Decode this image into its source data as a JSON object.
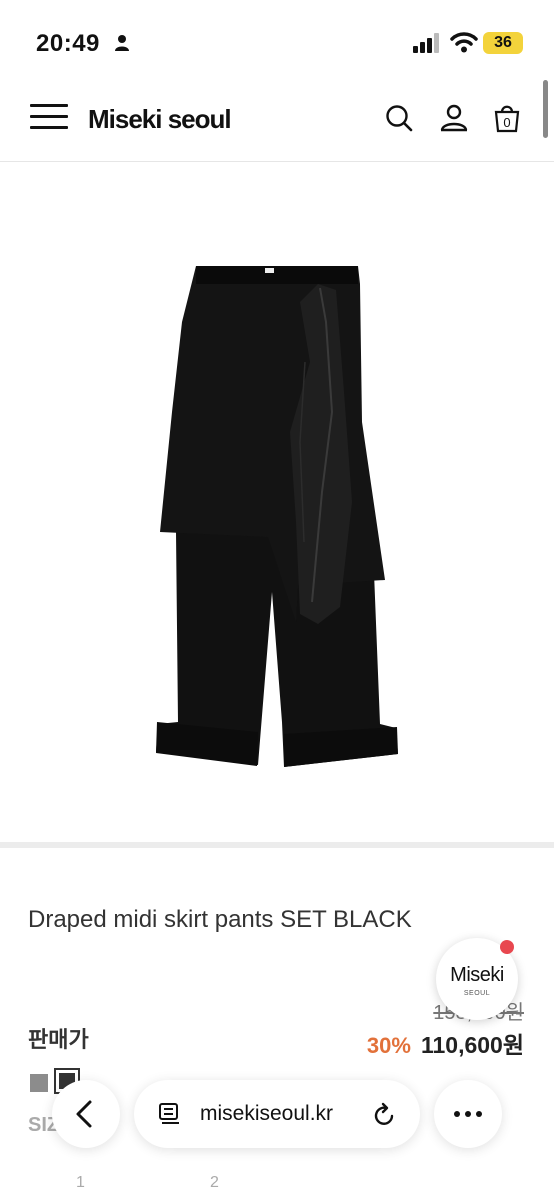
{
  "status_bar": {
    "time": "20:49",
    "battery": "36"
  },
  "header": {
    "brand": "Miseki seoul",
    "cart_count": "0"
  },
  "product": {
    "title": "Draped midi skirt pants SET BLACK",
    "price_label": "판매가",
    "original_price": "158,000원",
    "discount": "30%",
    "sale_price": "110,600원",
    "swatches": [
      "gray",
      "black"
    ],
    "size_label": "SIZE",
    "sizes": [
      "1",
      "2"
    ]
  },
  "badge": {
    "name": "Miseki",
    "sub": "SEOUL"
  },
  "browser": {
    "url": "misekiseoul.kr"
  },
  "colors": {
    "accent": "#e2713a",
    "notification_dot": "#e8474f"
  }
}
